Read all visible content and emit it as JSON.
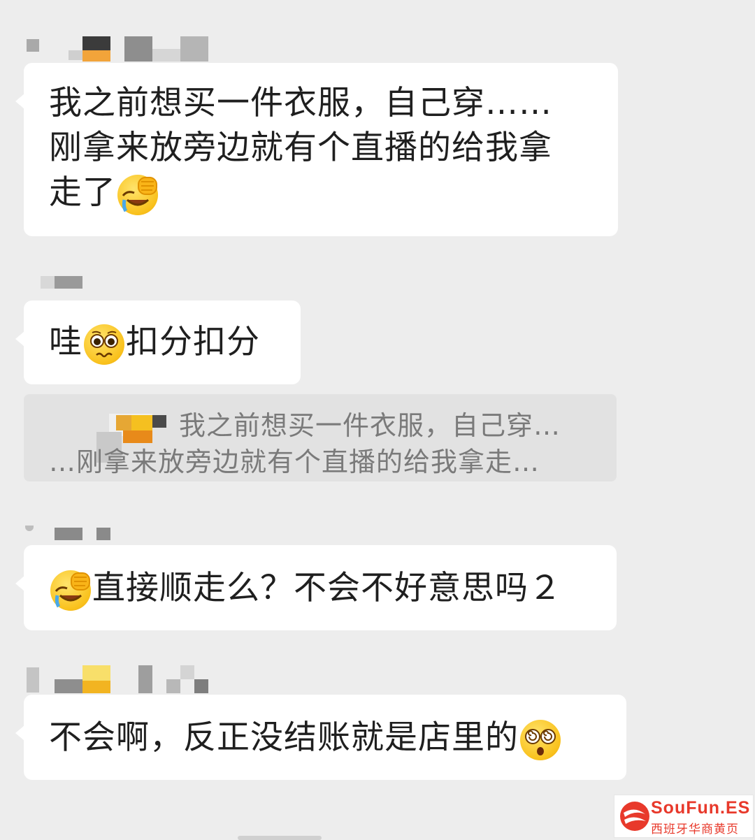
{
  "messages": [
    {
      "line1": "我之前想买一件衣服，自己穿……",
      "line2": "刚拿来放旁边就有个直播的给我拿",
      "line3": "走了",
      "emoji": "face-palm-crying-emoji"
    },
    {
      "text_a": "哇",
      "text_b": "扣分扣分",
      "emoji": "pleading-face-emoji"
    },
    {
      "text": "直接顺走么？不会不好意思吗２",
      "emoji": "face-palm-crying-emoji"
    },
    {
      "text": "不会啊，反正没结账就是店里的",
      "emoji": "dizzy-face-emoji"
    }
  ],
  "quote": {
    "line1": "我之前想买一件衣服，自己穿…",
    "line2": "…刚拿来放旁边就有个直播的给我拿走…"
  },
  "watermark": {
    "brand": "SouFun.ES",
    "subtitle": "西班牙华商黄页"
  },
  "colors": {
    "background": "#ededed",
    "bubble": "#ffffff",
    "quote_bg": "#e2e2e2",
    "watermark_red": "#e8392b"
  }
}
